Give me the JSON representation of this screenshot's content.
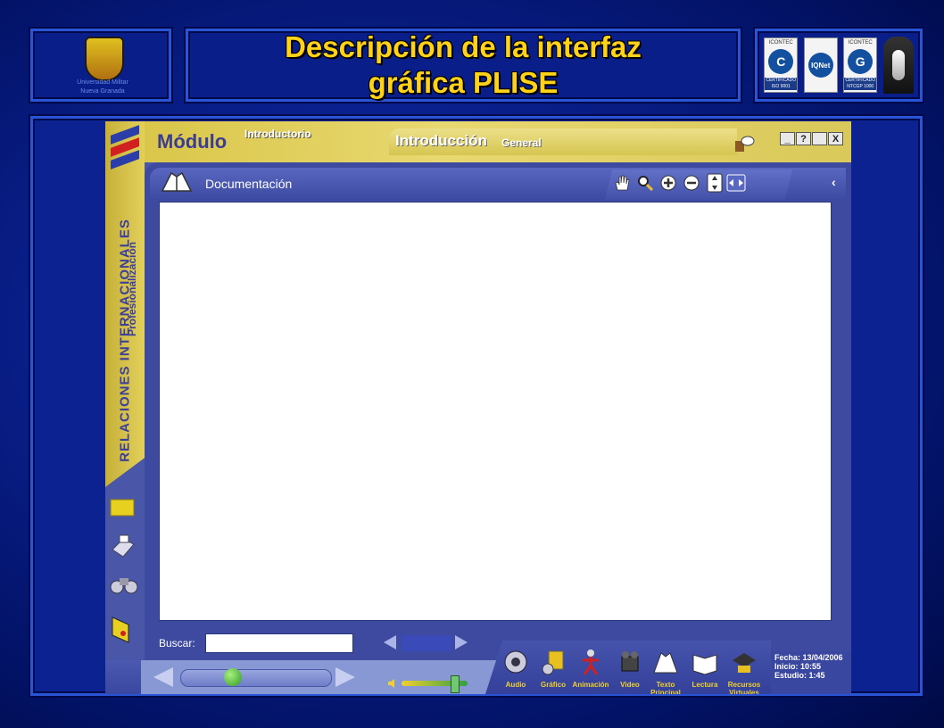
{
  "slide": {
    "title_line1": "Descripción de la interfaz",
    "title_line2": "gráfica PLISE"
  },
  "logo": {
    "line1": "Universidad Militar",
    "line2": "Nueva Granada"
  },
  "certs": [
    {
      "top": "ICONTEC",
      "mark": "C",
      "bottom1": "CERTIFICADO",
      "bottom2": "ISO 9001"
    },
    {
      "top": "",
      "mark": "IQNet",
      "bottom1": "",
      "bottom2": ""
    },
    {
      "top": "ICONTEC",
      "mark": "G",
      "bottom1": "CERTIFICADO",
      "bottom2": "NTCGP 1000"
    }
  ],
  "app": {
    "side_title": "RELACIONES INTERNACIONALES",
    "side_subtitle": "Profesionalización",
    "modulo": "Módulo",
    "modulo_sub": "Introductorio",
    "section_main": "Introducción",
    "section_sub": "General",
    "win_minimize": "_",
    "win_help": "?",
    "win_maximize": "",
    "win_close": "X",
    "doc_label": "Documentación",
    "search_label": "Buscar:",
    "search_value": "",
    "media": [
      {
        "name": "audio",
        "label": "Audio"
      },
      {
        "name": "grafico",
        "label": "Gráfico"
      },
      {
        "name": "animacion",
        "label": "Animación"
      },
      {
        "name": "video",
        "label": "Video"
      },
      {
        "name": "texto-principal",
        "label": "Texto Principal"
      },
      {
        "name": "lectura",
        "label": "Lectura"
      },
      {
        "name": "recursos-virtuales",
        "label": "Recursos Virtuales"
      }
    ],
    "info": {
      "fecha": "Fecha: 13/04/2006",
      "inicio": "Inicio: 10:55",
      "estudio": "Estudio: 1:45"
    },
    "progress": 0.35,
    "volume": 0.8
  },
  "colors": {
    "title_yellow": "#ffd21a",
    "panel_blue": "#0a1e8a",
    "app_purple": "#4a57a8",
    "header_gold": "#d7c445"
  }
}
